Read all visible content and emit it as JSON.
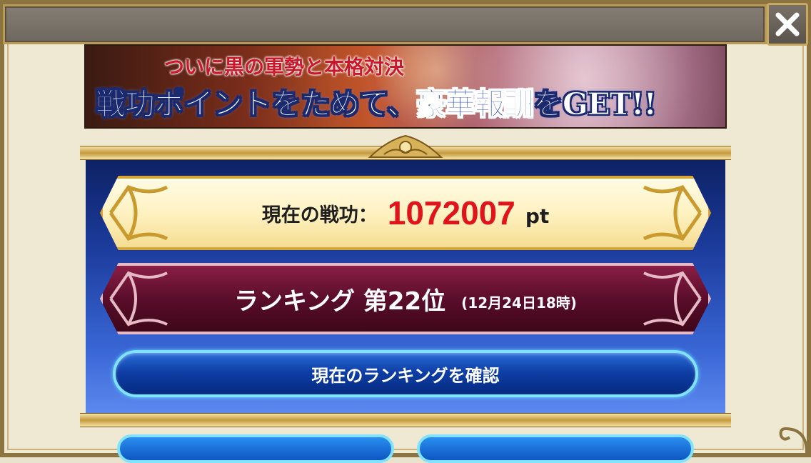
{
  "banner": {
    "subtitle": "ついに黒の軍勢と本格対決",
    "headline_part1": "戦功ポイントをためて、",
    "headline_highlight": "豪華報酬",
    "headline_part2": "をGET!!"
  },
  "points": {
    "label": "現在の戦功：",
    "value": "1072007",
    "unit": "pt"
  },
  "ranking": {
    "label": "ランキング 第22位",
    "timestamp": "(12月24日18時)"
  },
  "buttons": {
    "check_ranking": "現在のランキングを確認"
  },
  "colors": {
    "points_value": "#e0141b",
    "panel_blue": "#1b3a9a",
    "rank_maroon": "#5a0d2a",
    "button_glow": "#7fe2ff"
  },
  "icons": {
    "close": "close-icon",
    "crest": "crest-ornament-icon"
  }
}
